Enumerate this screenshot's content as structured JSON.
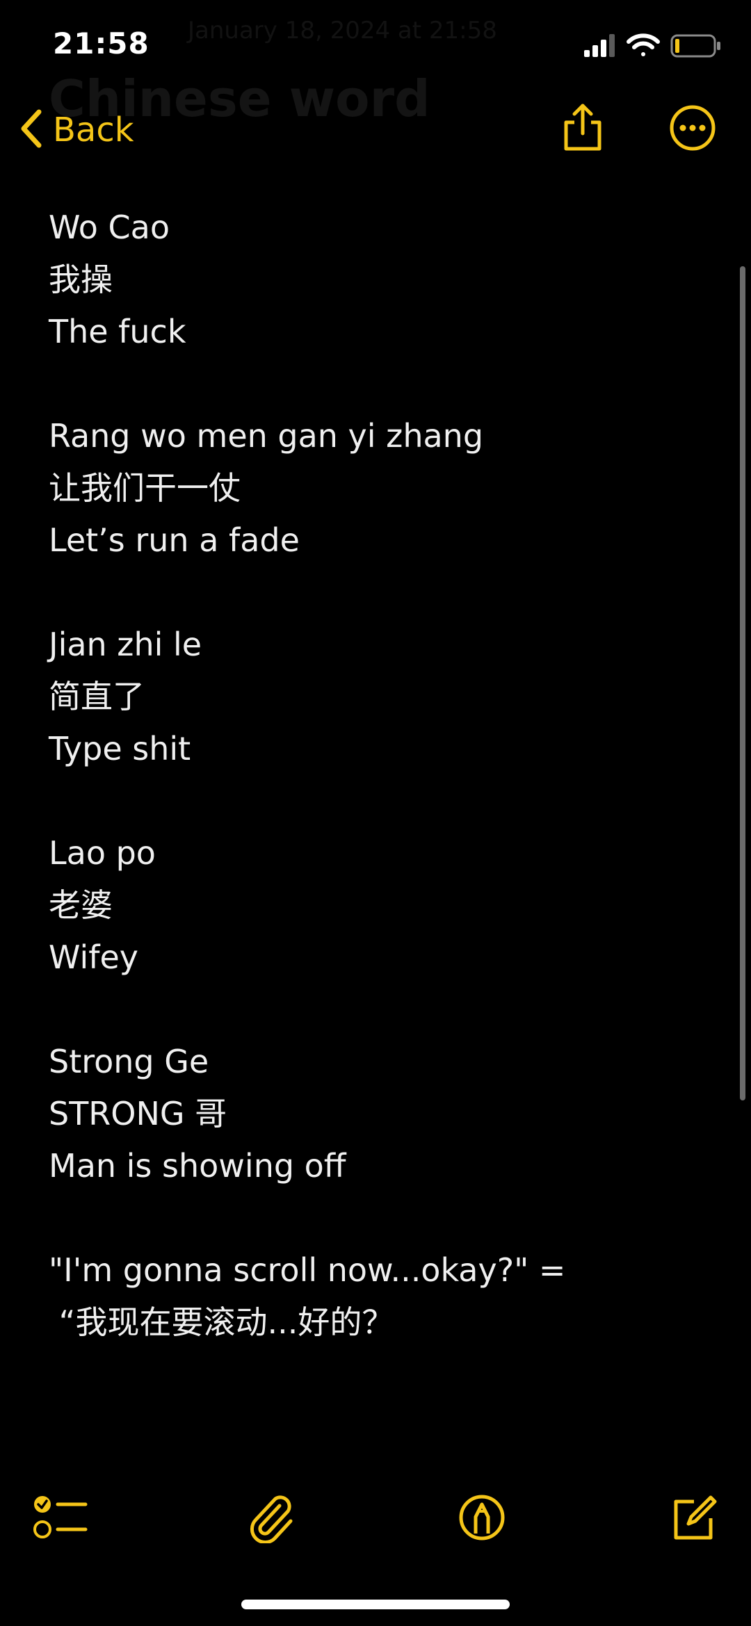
{
  "status_bar": {
    "time": "21:58"
  },
  "header": {
    "back_label": "Back",
    "ghost_title": "Chinese word",
    "ghost_subtitle": "January 18, 2024 at 21:58"
  },
  "note": {
    "blocks": [
      [
        "Wo Cao",
        "我操",
        "The fuck"
      ],
      [
        "Rang wo men gan yi zhang",
        "让我们干一仗",
        "Let’s run a fade"
      ],
      [
        "Jian zhi le",
        "简直了",
        "Type shit"
      ],
      [
        "Lao po",
        "老婆",
        "Wifey"
      ],
      [
        "Strong Ge",
        "STRONG 哥",
        "Man is showing off"
      ],
      [
        "\"I'm gonna scroll now...okay?\" =",
        " “我现在要滚动...好的？"
      ]
    ]
  },
  "icons": {
    "back": "chevron-left-icon",
    "share": "share-icon",
    "more": "ellipsis-circle-icon",
    "checklist": "checklist-icon",
    "attachment": "paperclip-icon",
    "markup": "pen-circle-icon",
    "compose": "compose-icon"
  },
  "colors": {
    "accent": "#f5c518",
    "background": "#000000",
    "text": "#f0f0f0"
  }
}
